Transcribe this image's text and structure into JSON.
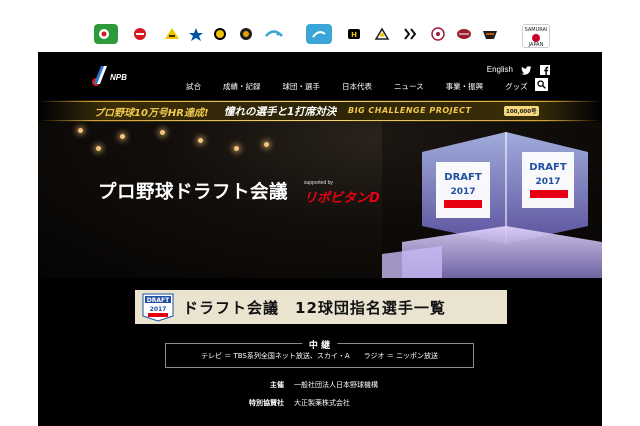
{
  "teams": [
    {
      "name": "carp-icon",
      "bg": "#2e9a3b",
      "label": ""
    },
    {
      "name": "carp2-icon",
      "bg": "#ffffff",
      "label": ""
    },
    {
      "name": "tigers-icon",
      "bg": "#ffffff",
      "label": ""
    },
    {
      "name": "baystars-icon",
      "bg": "#ffffff",
      "label": ""
    },
    {
      "name": "giants-icon",
      "bg": "#ffffff",
      "label": ""
    },
    {
      "name": "swallows-icon",
      "bg": "#ffffff",
      "label": ""
    },
    {
      "name": "dragons-icon",
      "bg": "#ffffff",
      "label": ""
    },
    {
      "name": "hawks-icon",
      "bg": "#ffffff",
      "label": ""
    },
    {
      "name": "fighters-icon",
      "bg": "#ffffff",
      "label": ""
    },
    {
      "name": "marines-icon",
      "bg": "#ffffff",
      "label": ""
    },
    {
      "name": "lions-icon",
      "bg": "#ffffff",
      "label": ""
    },
    {
      "name": "eagles-icon",
      "bg": "#ffffff",
      "label": ""
    },
    {
      "name": "buffaloes-icon",
      "bg": "#ffffff",
      "label": ""
    }
  ],
  "samurai": {
    "line1": "SAMURAI",
    "line2": "JAPAN"
  },
  "header": {
    "logo_text": "NPB",
    "english_link": "English",
    "twitter_icon": "twitter-icon",
    "facebook_icon": "facebook-icon",
    "nav": [
      "試合",
      "成績・記録",
      "球団・選手",
      "日本代表",
      "ニュース",
      "事業・振興",
      "グッズ"
    ],
    "search_icon": "search-icon"
  },
  "banner": {
    "part1": "プロ野球10万号HR達成!",
    "part2": "憧れの選手と1打席対決",
    "part3": "BIG CHALLENGE PROJECT",
    "badge": "100,000号"
  },
  "hero": {
    "title": "プロ野球ドラフト会議",
    "sponsor_small": "supported by",
    "sponsor": "リポビタンD",
    "trophy_label_top": "DRAFT",
    "trophy_label_year": "2017"
  },
  "draft_heading": {
    "logo_top": "DRAFT",
    "logo_year": "2017",
    "title": "ドラフト会議　12球団指名選手一覧"
  },
  "broadcast": {
    "label": "中 継",
    "body": "テレビ ＝ TBS系列全国ネット放送、スカイ・A　　ラジオ ＝ ニッポン放送"
  },
  "credits": {
    "organizer_key": "主催",
    "organizer_value": "一般社団法人日本野球機構",
    "sponsor_key": "特別協賛社",
    "sponsor_value": "大正製薬株式会社"
  },
  "colors": {
    "accent_gold": "#f1c950",
    "sponsor_red": "#e60012",
    "heading_bg": "#e9e3cf"
  }
}
